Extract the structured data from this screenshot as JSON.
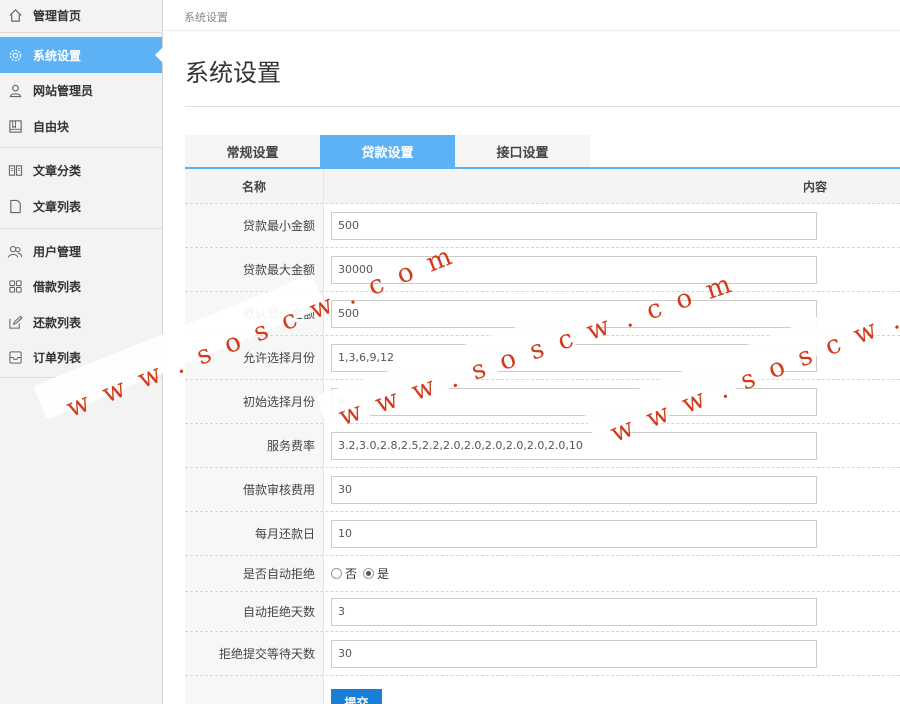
{
  "sidebar": {
    "items": [
      {
        "label": "管理首页",
        "icon": "home-icon",
        "active": false
      },
      {
        "label": "系统设置",
        "icon": "gear-icon",
        "active": true
      },
      {
        "label": "网站管理员",
        "icon": "user-icon",
        "active": false
      },
      {
        "label": "自由块",
        "icon": "book-icon",
        "active": false
      },
      {
        "label": "文章分类",
        "icon": "open-book-icon",
        "active": false
      },
      {
        "label": "文章列表",
        "icon": "file-icon",
        "active": false
      },
      {
        "label": "用户管理",
        "icon": "users-icon",
        "active": false
      },
      {
        "label": "借款列表",
        "icon": "grid-icon",
        "active": false
      },
      {
        "label": "还款列表",
        "icon": "edit-icon",
        "active": false
      },
      {
        "label": "订单列表",
        "icon": "inbox-icon",
        "active": false
      }
    ]
  },
  "breadcrumb": "系统设置",
  "page_title": "系统设置",
  "tabs": [
    {
      "label": "常规设置",
      "active": false
    },
    {
      "label": "贷款设置",
      "active": true
    },
    {
      "label": "接口设置",
      "active": false
    }
  ],
  "table": {
    "col_name": "名称",
    "col_content": "内容",
    "rows": [
      {
        "label": "贷款最小金额",
        "value": "500"
      },
      {
        "label": "贷款最大金额",
        "value": "30000"
      },
      {
        "label": "默认显示金额",
        "value": "500"
      },
      {
        "label": "允许选择月份",
        "value": "1,3,6,9,12"
      },
      {
        "label": "初始选择月份",
        "value": "6"
      },
      {
        "label": "服务费率",
        "value": "3.2,3.0,2.8,2.5,2.2,2.0,2.0,2.0,2.0,2.0,2.0,10"
      },
      {
        "label": "借款审核费用",
        "value": "30"
      },
      {
        "label": "每月还款日",
        "value": "10"
      }
    ],
    "auto_reject": {
      "label": "是否自动拒绝",
      "option_no": "否",
      "option_yes": "是",
      "selected": "是"
    },
    "rows2": [
      {
        "label": "自动拒绝天数",
        "value": "3"
      },
      {
        "label": "拒绝提交等待天数",
        "value": "30"
      }
    ],
    "submit_label": "提交"
  },
  "watermark": "www.soscw.com",
  "colors": {
    "accent": "#5db2f5",
    "submit": "#1a7fd4",
    "watermark": "#d23a1a"
  }
}
